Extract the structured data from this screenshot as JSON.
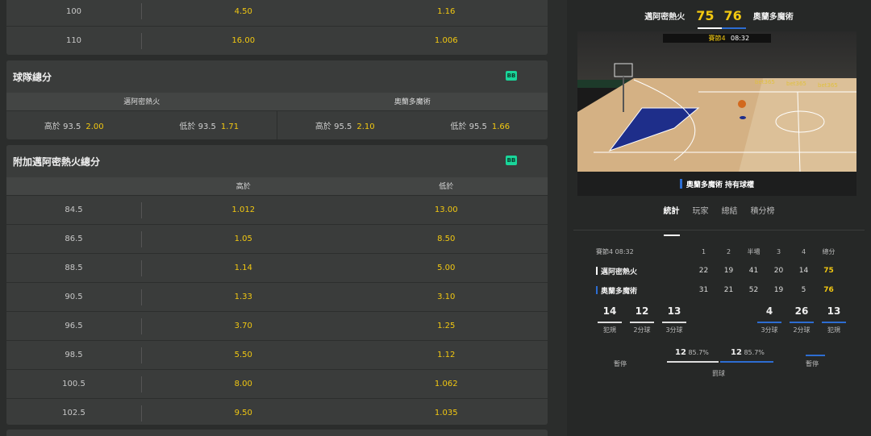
{
  "top_table": {
    "rows": [
      {
        "line": "100",
        "over": "4.50",
        "under": "1.16"
      },
      {
        "line": "110",
        "over": "16.00",
        "under": "1.006"
      }
    ]
  },
  "team_totals": {
    "title": "球隊總分",
    "badge": "BB",
    "teams": [
      "邁阿密熱火",
      "奧蘭多魔術"
    ],
    "cells": [
      {
        "label": "高於",
        "line": "93.5",
        "odds": "2.00"
      },
      {
        "label": "低於",
        "line": "93.5",
        "odds": "1.71"
      },
      {
        "label": "高於",
        "line": "95.5",
        "odds": "2.10"
      },
      {
        "label": "低於",
        "line": "95.5",
        "odds": "1.66"
      }
    ]
  },
  "alt_totals": {
    "title": "附加邁阿密熱火總分",
    "badge": "BB",
    "headers": [
      "高於",
      "低於"
    ],
    "rows": [
      {
        "line": "84.5",
        "over": "1.012",
        "under": "13.00"
      },
      {
        "line": "86.5",
        "over": "1.05",
        "under": "8.50"
      },
      {
        "line": "88.5",
        "over": "1.14",
        "under": "5.00"
      },
      {
        "line": "90.5",
        "over": "1.33",
        "under": "3.10"
      },
      {
        "line": "96.5",
        "over": "3.70",
        "under": "1.25"
      },
      {
        "line": "98.5",
        "over": "5.50",
        "under": "1.12"
      },
      {
        "line": "100.5",
        "over": "8.00",
        "under": "1.062"
      },
      {
        "line": "102.5",
        "over": "9.50",
        "under": "1.035"
      }
    ]
  },
  "match": {
    "home": "邁阿密熱火",
    "away": "奧蘭多魔術",
    "home_score": "75",
    "away_score": "76",
    "clock_label": "賽節4",
    "clock": "08:32",
    "possession": "奧蘭多魔術 持有球權",
    "board": "bet365",
    "tabs": [
      "統計",
      "玩家",
      "總結",
      "積分榜"
    ]
  },
  "scoreboard": {
    "period": "賽節4",
    "time": "08:32",
    "headers": [
      "1",
      "2",
      "半場",
      "3",
      "4",
      "總分"
    ],
    "home": {
      "name": "邁阿密熱火",
      "q": [
        "22",
        "19",
        "41",
        "20",
        "14"
      ],
      "total": "75"
    },
    "away": {
      "name": "奧蘭多魔術",
      "q": [
        "31",
        "21",
        "52",
        "19",
        "5"
      ],
      "total": "76"
    }
  },
  "stats": {
    "home": [
      {
        "n": "14",
        "l": "犯規"
      },
      {
        "n": "12",
        "l": "2分球"
      },
      {
        "n": "13",
        "l": "3分球"
      }
    ],
    "away": [
      {
        "n": "4",
        "l": "3分球"
      },
      {
        "n": "26",
        "l": "2分球"
      },
      {
        "n": "13",
        "l": "犯規"
      }
    ],
    "timeout_label": "暫停",
    "ft_label": "罰球",
    "ft_home": {
      "n": "12",
      "pct": "85.7%"
    },
    "ft_away": {
      "n": "12",
      "pct": "85.7%"
    }
  }
}
